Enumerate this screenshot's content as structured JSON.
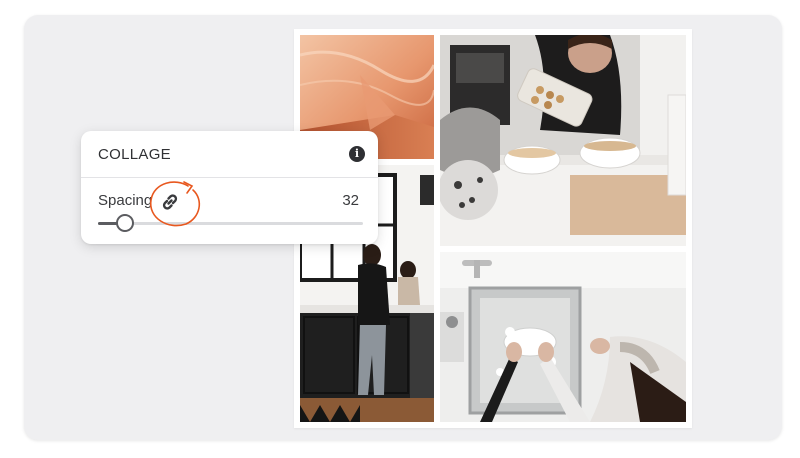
{
  "panel": {
    "title": "COLLAGE",
    "info_icon": "info-icon",
    "spacing_label": "Spacing",
    "spacing_value": "32",
    "link_icon": "link-icon",
    "slider_level": 0.1
  },
  "colors": {
    "annotation": "#e8581f",
    "canvas": "#efeff1",
    "panel": "#ffffff"
  },
  "collage": {
    "images": [
      "copper-texture-photo",
      "woman-pouring-cereal-photo",
      "kitchen-mother-child-photo",
      "washing-dishes-sink-photo"
    ]
  }
}
